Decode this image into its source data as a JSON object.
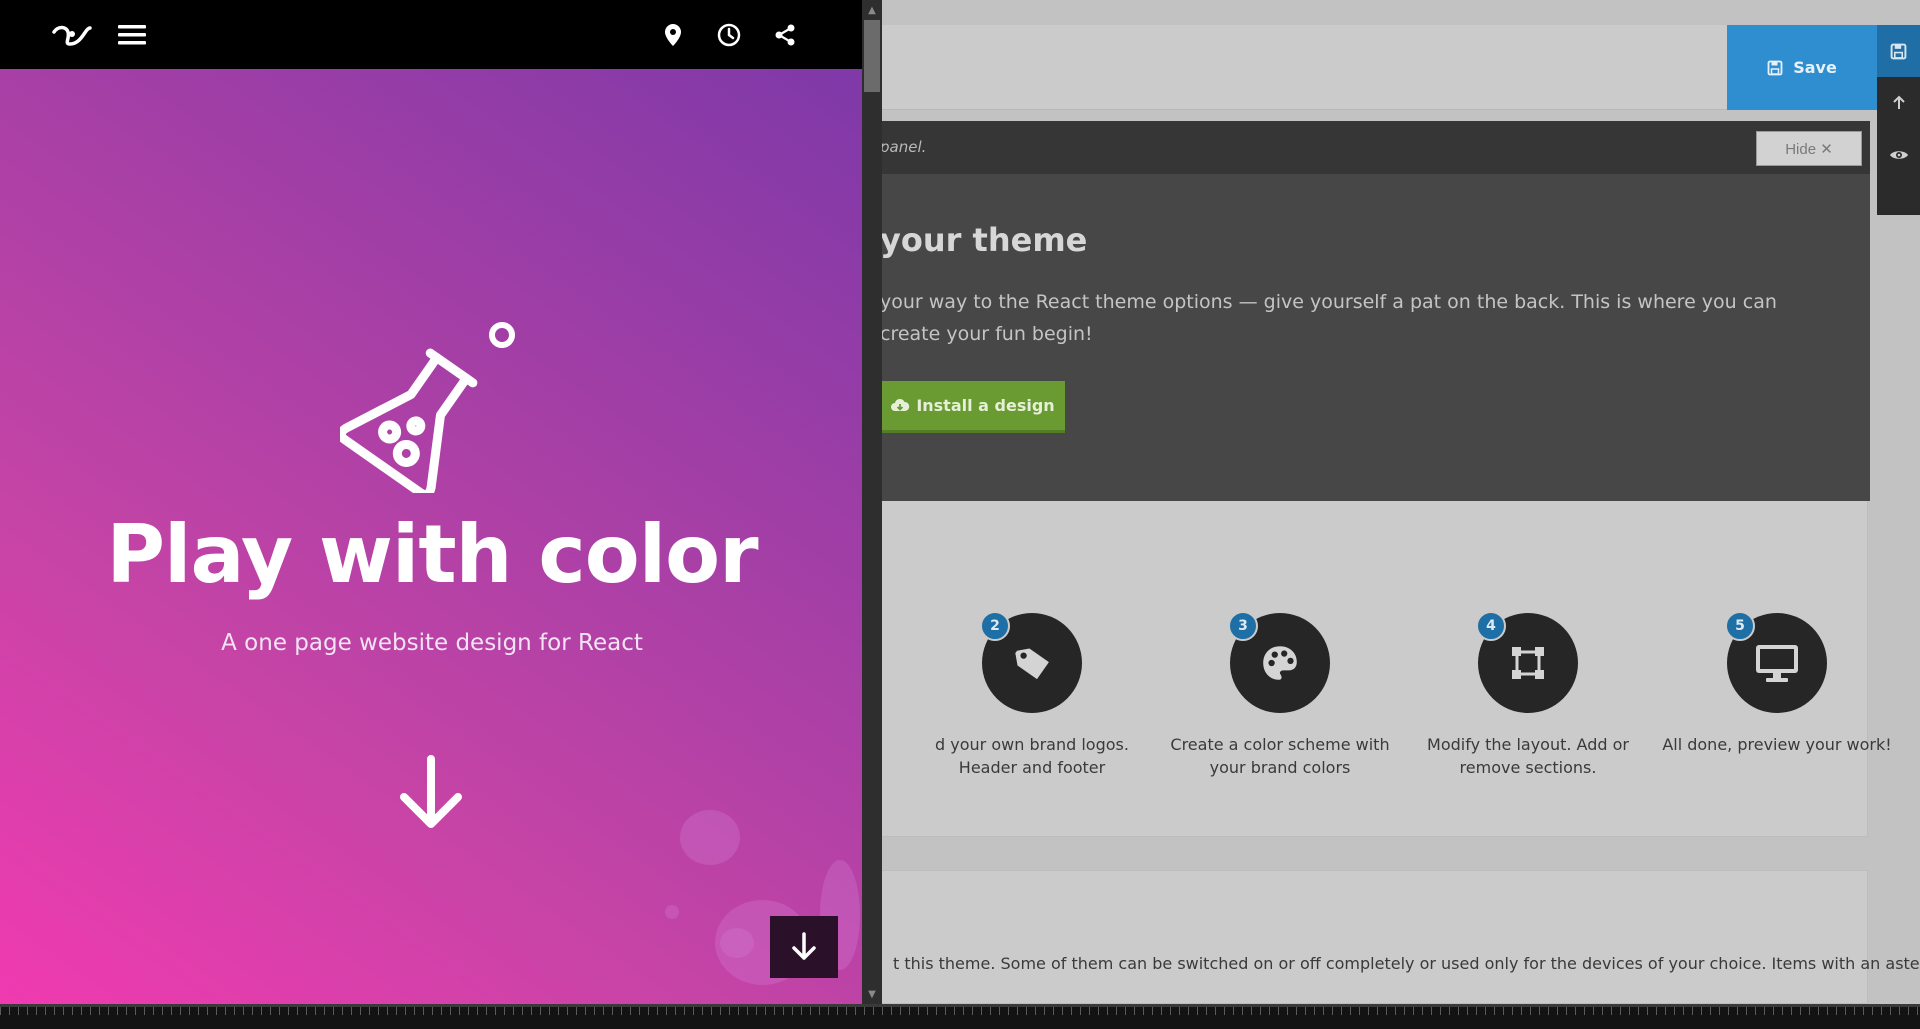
{
  "preview": {
    "hero_title": "Play with color",
    "hero_subtitle": "A one page website design for React",
    "icons": [
      "react-logo-icon",
      "menu-icon",
      "location-pin-icon",
      "clock-icon",
      "share-icon",
      "flask-icon",
      "arrow-down-icon"
    ]
  },
  "admin": {
    "save_label": "Save",
    "welcome": {
      "hint": "panel.",
      "hide_label": "Hide ✕",
      "title": "your theme",
      "body": "your way to the React theme options — give yourself a pat on the back. This is where you can create your fun begin!",
      "install_label": "Install a design"
    },
    "steps": [
      {
        "num": "2",
        "caption": "d your own brand logos. Header and footer"
      },
      {
        "num": "3",
        "caption": "Create a color scheme with your brand colors"
      },
      {
        "num": "4",
        "caption": "Modify the layout. Add or remove sections."
      },
      {
        "num": "5",
        "caption": "All done, preview your work!"
      }
    ],
    "features_text": "t this theme. Some of them can be switched on or off completely or used only for the devices of your choice. Items with an asterisk"
  },
  "colors": {
    "accent": "#2f8ecf",
    "install": "#6a9a32",
    "hero_from": "#7a38a8",
    "hero_to": "#f03ab0"
  }
}
